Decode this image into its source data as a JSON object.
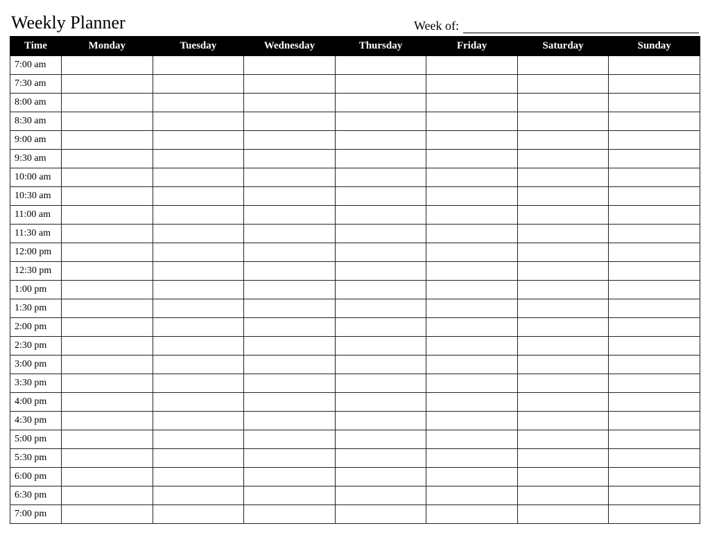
{
  "header": {
    "title": "Weekly Planner",
    "week_of_label": "Week of:",
    "week_of_value": ""
  },
  "columns": {
    "time": "Time",
    "days": [
      "Monday",
      "Tuesday",
      "Wednesday",
      "Thursday",
      "Friday",
      "Saturday",
      "Sunday"
    ]
  },
  "times": [
    "7:00 am",
    "7:30 am",
    "8:00 am",
    "8:30 am",
    "9:00 am",
    "9:30 am",
    "10:00 am",
    "10:30 am",
    "11:00 am",
    "11:30 am",
    "12:00 pm",
    "12:30 pm",
    "1:00 pm",
    "1:30 pm",
    "2:00 pm",
    "2:30 pm",
    "3:00 pm",
    "3:30 pm",
    "4:00 pm",
    "4:30 pm",
    "5:00 pm",
    "5:30 pm",
    "6:00 pm",
    "6:30 pm",
    "7:00 pm"
  ],
  "cells": {}
}
